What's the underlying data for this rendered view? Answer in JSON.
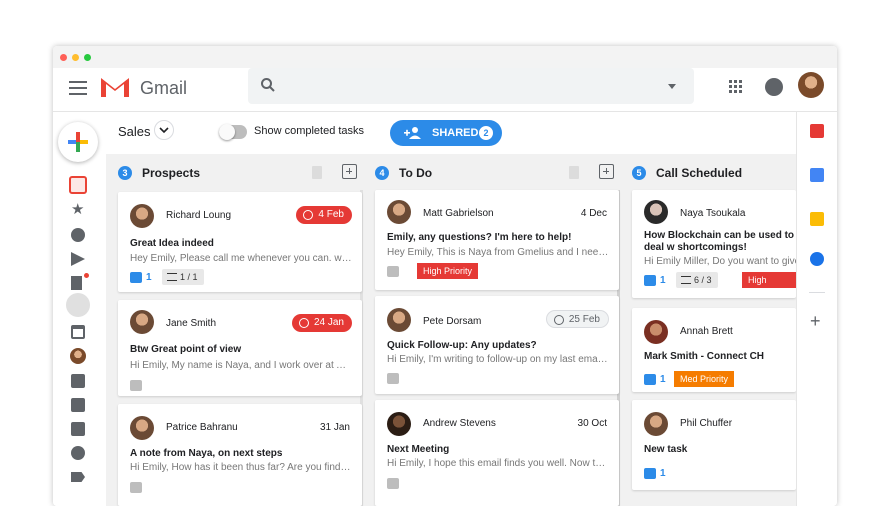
{
  "app": {
    "name": "Gmail",
    "brand_color": "#ea4335"
  },
  "search": {
    "placeholder": ""
  },
  "board": {
    "name": "Sales",
    "toggle_label": "Show completed tasks",
    "shared_label": "SHARED",
    "shared_count": "2"
  },
  "columns": [
    {
      "count": "3",
      "title": "Prospects",
      "cards": [
        {
          "name": "Richard Loung",
          "badge": "4 Feb",
          "badge_style": "red",
          "subject": "Great Idea indeed",
          "snippet": "Hey Emily, Please call me whenever you can. www.g...",
          "likes": "1",
          "tasks": "1 / 1"
        },
        {
          "name": "Jane Smith",
          "badge": "24 Jan",
          "badge_style": "red",
          "subject": "Btw Great point of view",
          "snippet": "Hi Emily, My name is Naya, and I work over at Acm..."
        },
        {
          "name": "Patrice Bahranu",
          "date": "31 Jan",
          "subject": "A note from Naya, on next steps",
          "snippet": "Hi Emily, How has it been thus far? Are you finding e..."
        }
      ]
    },
    {
      "count": "4",
      "title": "To Do",
      "cards": [
        {
          "name": "Matt Gabrielson",
          "date": "4 Dec",
          "subject": "Emily, any questions? I'm here to help!",
          "snippet": "Hey Emily, This is Naya from Gmelius and I need to ta...",
          "priority": "High Priority",
          "priority_color": "#e53935"
        },
        {
          "name": "Pete Dorsam",
          "badge": "25 Feb",
          "badge_style": "gray",
          "subject": "Quick Follow-up: Any updates?",
          "snippet": "Hi Emily, I'm writing to follow-up on my last email. I ..."
        },
        {
          "name": "Andrew Stevens",
          "date": "30 Oct",
          "subject": "Next Meeting",
          "snippet": "Hi Emily, I hope this email finds you well. Now that t..."
        }
      ]
    },
    {
      "count": "5",
      "title": "Call Scheduled",
      "cards": [
        {
          "name": "Naya Tsoukala",
          "subject": "How Blockchain can be used to deal w shortcomings!",
          "snippet": "Hi Emily Miller, Do you want to give m",
          "likes": "1",
          "tasks": "6 / 3",
          "priority": "High Priority",
          "priority_color": "#e53935"
        },
        {
          "name": "Annah Brett",
          "subject": "Mark Smith - Connect CH",
          "likes": "1",
          "priority": "Med Priority",
          "priority_color": "#f57c00"
        },
        {
          "name": "Phil Chuffer",
          "subject": "New task",
          "likes": "1"
        }
      ]
    }
  ]
}
